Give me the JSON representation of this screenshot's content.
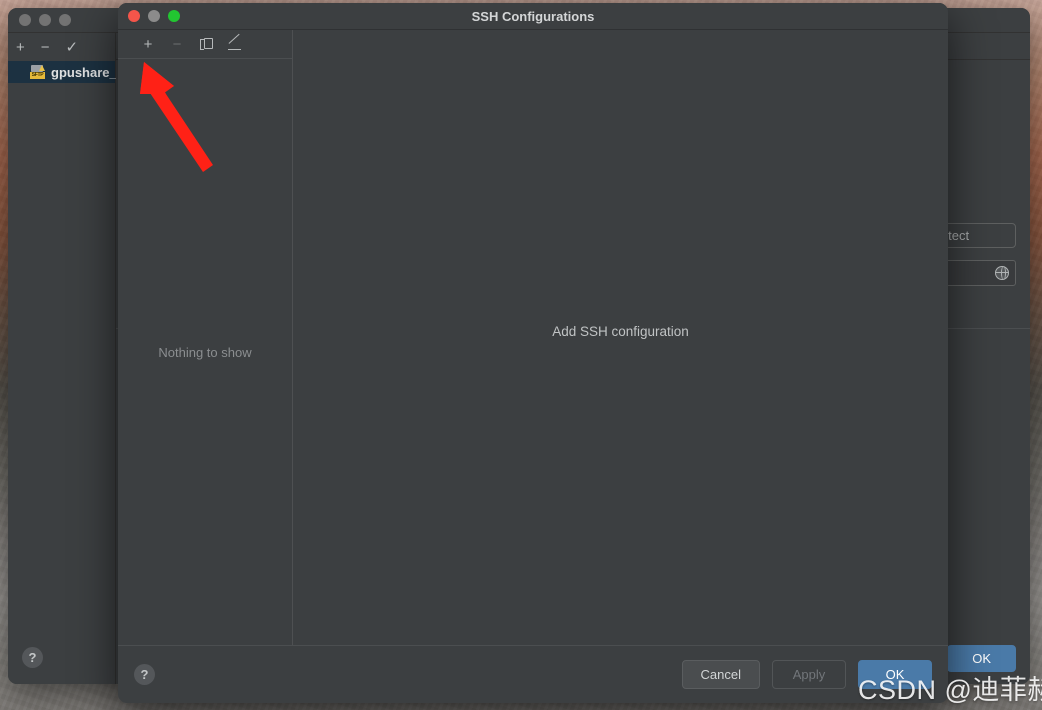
{
  "desktop": {
    "wallpaper_description": "rocky-landscape-wallpaper"
  },
  "background_window": {
    "titlebar": {
      "traffic_lights": [
        "close",
        "minimize",
        "zoom"
      ]
    },
    "left_panel": {
      "toolbar": [
        {
          "name": "add",
          "glyph": "+"
        },
        {
          "name": "remove",
          "glyph": "−"
        },
        {
          "name": "apply-check",
          "glyph": "✓"
        }
      ],
      "selected_item": {
        "label": "gpushare_",
        "icon": "sftp-icon",
        "icon_text": "SFTP"
      }
    },
    "form": {
      "autodetect_button": "todetect",
      "web_field_icon": "globe-icon"
    },
    "footer": {
      "help_label": "?",
      "ok_label": "OK"
    }
  },
  "ssh_dialog": {
    "title": "SSH Configurations",
    "titlebar": {
      "close_color": "#f4554a",
      "minimize_color": "#8b8b8b",
      "zoom_color": "#22c531"
    },
    "toolbar": [
      {
        "name": "add-configuration",
        "glyph": "+",
        "enabled": true
      },
      {
        "name": "remove-configuration",
        "glyph": "−",
        "enabled": false
      },
      {
        "name": "copy-configuration",
        "glyph": "copy-icon",
        "enabled": true
      },
      {
        "name": "edit-configuration",
        "glyph": "pencil-icon",
        "enabled": true
      }
    ],
    "list_empty_text": "Nothing to show",
    "main_empty_text": "Add SSH configuration",
    "footer": {
      "help_label": "?",
      "cancel_label": "Cancel",
      "apply_label": "Apply",
      "apply_enabled": false,
      "ok_label": "OK",
      "ok_enabled": true,
      "ok_color": "#4a7aa8"
    }
  },
  "annotation": {
    "arrow_color": "#ff2116",
    "points_to": "add-configuration-button"
  },
  "watermark": {
    "text": "CSDN @迪菲赫尔曼"
  }
}
